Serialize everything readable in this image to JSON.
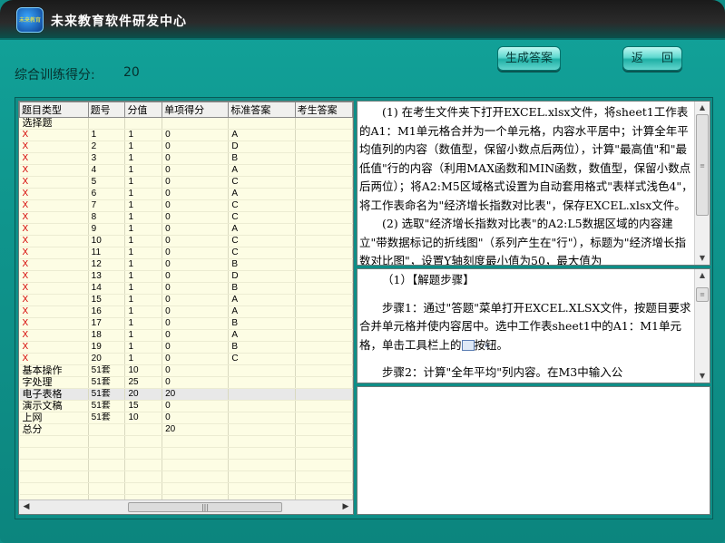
{
  "app": {
    "title": "未来教育软件研发中心",
    "logo_text": "未来教育"
  },
  "score": {
    "label": "综合训练得分:",
    "value": "20"
  },
  "buttons": {
    "generate": "生成答案",
    "back": "返 回"
  },
  "grid": {
    "columns": [
      "题目类型",
      "题号",
      "分值",
      "单项得分",
      "标准答案",
      "考生答案"
    ],
    "rows": [
      [
        "选择题",
        "",
        "",
        "",
        "",
        ""
      ],
      [
        "X",
        "1",
        "1",
        "0",
        "A",
        ""
      ],
      [
        "X",
        "2",
        "1",
        "0",
        "D",
        ""
      ],
      [
        "X",
        "3",
        "1",
        "0",
        "B",
        ""
      ],
      [
        "X",
        "4",
        "1",
        "0",
        "A",
        ""
      ],
      [
        "X",
        "5",
        "1",
        "0",
        "C",
        ""
      ],
      [
        "X",
        "6",
        "1",
        "0",
        "A",
        ""
      ],
      [
        "X",
        "7",
        "1",
        "0",
        "C",
        ""
      ],
      [
        "X",
        "8",
        "1",
        "0",
        "C",
        ""
      ],
      [
        "X",
        "9",
        "1",
        "0",
        "A",
        ""
      ],
      [
        "X",
        "10",
        "1",
        "0",
        "C",
        ""
      ],
      [
        "X",
        "11",
        "1",
        "0",
        "C",
        ""
      ],
      [
        "X",
        "12",
        "1",
        "0",
        "B",
        ""
      ],
      [
        "X",
        "13",
        "1",
        "0",
        "D",
        ""
      ],
      [
        "X",
        "14",
        "1",
        "0",
        "B",
        ""
      ],
      [
        "X",
        "15",
        "1",
        "0",
        "A",
        ""
      ],
      [
        "X",
        "16",
        "1",
        "0",
        "A",
        ""
      ],
      [
        "X",
        "17",
        "1",
        "0",
        "B",
        ""
      ],
      [
        "X",
        "18",
        "1",
        "0",
        "A",
        ""
      ],
      [
        "X",
        "19",
        "1",
        "0",
        "B",
        ""
      ],
      [
        "X",
        "20",
        "1",
        "0",
        "C",
        ""
      ],
      [
        "基本操作",
        "51套",
        "10",
        "0",
        "",
        ""
      ],
      [
        "字处理",
        "51套",
        "25",
        "0",
        "",
        ""
      ],
      [
        "电子表格",
        "51套",
        "20",
        "20",
        "",
        ""
      ],
      [
        "演示文稿",
        "51套",
        "15",
        "0",
        "",
        ""
      ],
      [
        "上网",
        "51套",
        "10",
        "0",
        "",
        ""
      ],
      [
        "总分",
        "",
        "",
        "20",
        "",
        ""
      ]
    ],
    "selected_row": 23,
    "empty_rows": 7
  },
  "question_text": {
    "paragraphs": [
      "(1) 在考生文件夹下打开EXCEL.xlsx文件，将sheet1工作表的A1：M1单元格合并为一个单元格，内容水平居中；计算全年平均值列的内容（数值型，保留小数点后两位），计算\"最高值\"和\"最低值\"行的内容（利用MAX函数和MIN函数，数值型，保留小数点后两位）；将A2:M5区域格式设置为自动套用格式\"表样式浅色4\"，将工作表命名为\"经济增长指数对比表\"，保存EXCEL.xlsx文件。",
      "(2) 选取\"经济增长指数对比表\"的A2:L5数据区域的内容建立\"带数据标记的折线图\"（系列产生在\"行\"），标题为\"经济增长指数对比图\"，设置Y轴刻度最小值为50，最大值为"
    ]
  },
  "solution_text": {
    "heading": "（1）【解题步骤】",
    "step1_before_icon": "步骤1：通过\"答题\"菜单打开EXCEL.XLSX文件，按题目要求合并单元格并使内容居中。选中工作表sheet1中的A1：M1单元格，单击工具栏上的",
    "step1_icon": "merge-center-icon",
    "step1_after_icon": "按钮。",
    "step2": "步骤2：计算\"全年平均\"列内容。在M3中输入公"
  },
  "colors": {
    "wrong_mark": "#d40000",
    "window": "#0f958d",
    "grid_bg": "#fdfde4"
  }
}
